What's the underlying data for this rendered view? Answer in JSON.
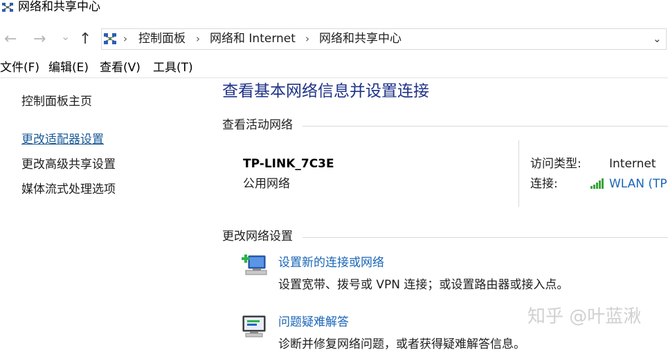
{
  "window": {
    "title": "网络和共享中心"
  },
  "navigation": {
    "back_glyph": "←",
    "forward_glyph": "→",
    "recent_glyph": "⌄",
    "up_glyph": "↑",
    "breadcrumbs": [
      "控制面板",
      "网络和 Internet",
      "网络和共享中心"
    ],
    "separator": "›",
    "dropdown_glyph": "⌄"
  },
  "menubar": {
    "items": [
      "文件(F)",
      "编辑(E)",
      "查看(V)",
      "工具(T)"
    ]
  },
  "sidebar": {
    "home": "控制面板主页",
    "links": [
      "更改适配器设置",
      "更改高级共享设置",
      "媒体流式处理选项"
    ]
  },
  "main": {
    "title": "查看基本网络信息并设置连接",
    "active_networks_header": "查看活动网络",
    "network": {
      "name": "TP-LINK_7C3E",
      "type": "公用网络",
      "access_label": "访问类型:",
      "access_value": "Internet",
      "connection_label": "连接:",
      "connection_value": "WLAN (TP"
    },
    "change_settings_header": "更改网络设置",
    "tasks": [
      {
        "title": "设置新的连接或网络",
        "desc": "设置宽带、拨号或 VPN 连接；或设置路由器或接入点。"
      },
      {
        "title": "问题疑难解答",
        "desc": "诊断并修复网络问题，或者获得疑难解答信息。"
      }
    ]
  },
  "watermark": "知乎 @叶蓝湫",
  "icons": {
    "title": "network-sharing-center-icon",
    "address": "network-sharing-center-icon",
    "wifi": "wifi-signal-icon",
    "new_connection": "new-connection-icon",
    "troubleshoot": "troubleshoot-icon"
  },
  "colors": {
    "link": "#1a66b7",
    "title": "#1e3287",
    "signal": "#3aa33a"
  }
}
